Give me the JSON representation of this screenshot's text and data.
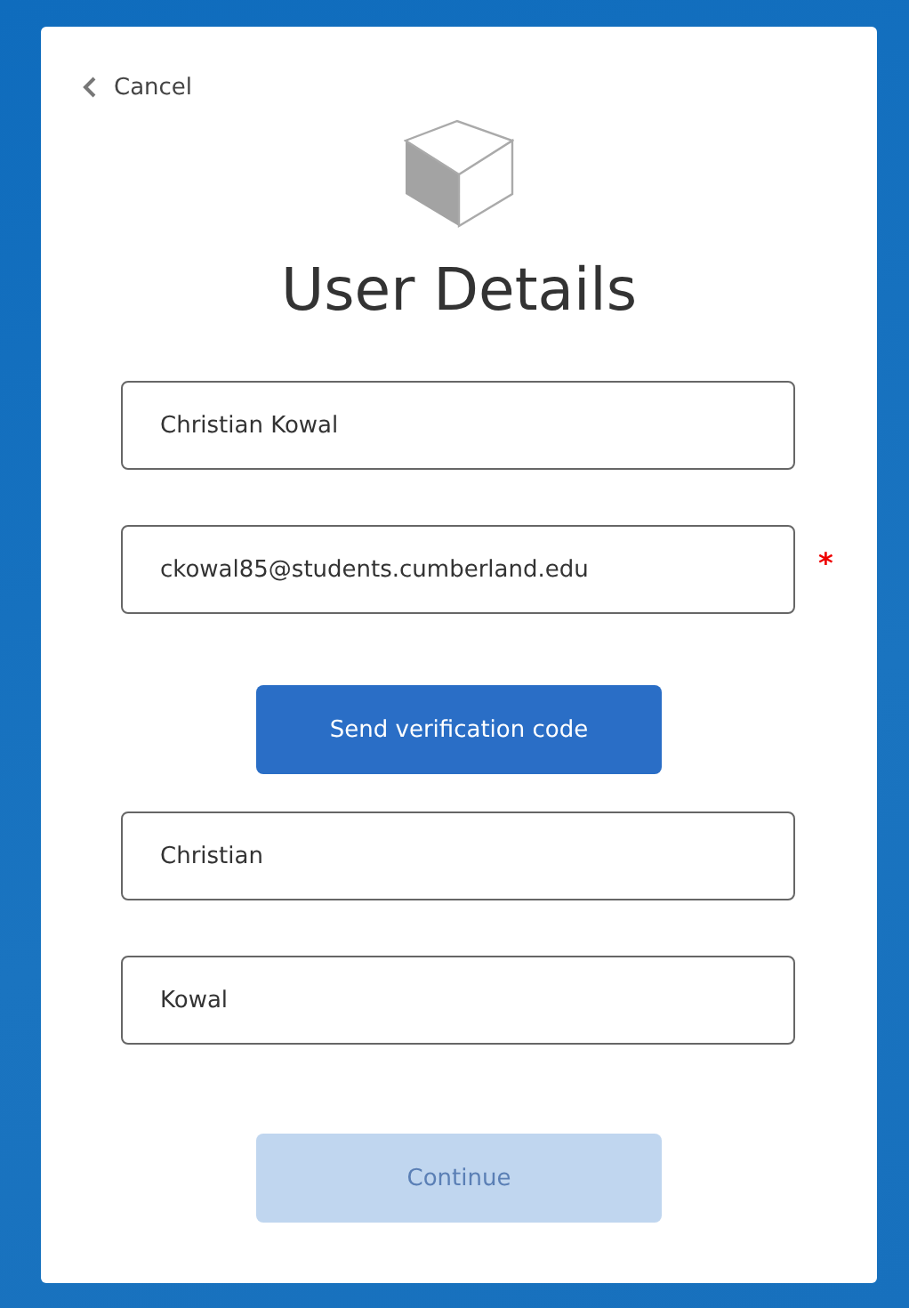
{
  "cancel": {
    "label": "Cancel"
  },
  "title": "User Details",
  "fields": [
    {
      "value": "Christian Kowal",
      "required": false
    },
    {
      "value": "ckowal85@students.cumberland.edu",
      "required": true
    },
    {
      "kind": "button",
      "label": "Send verification code",
      "disabled": false
    },
    {
      "value": "Christian",
      "required": false
    },
    {
      "value": "Kowal",
      "required": false
    }
  ],
  "continue": {
    "label": "Continue",
    "disabled": true
  },
  "required_mark": "*"
}
